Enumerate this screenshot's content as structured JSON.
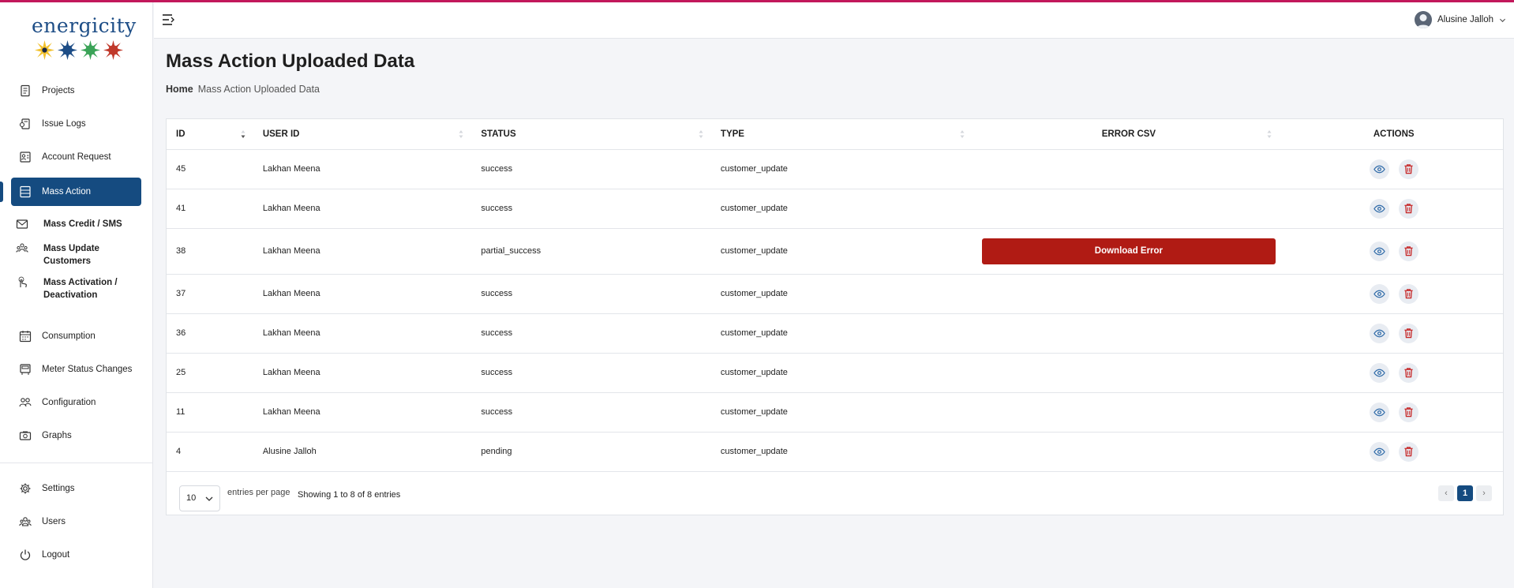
{
  "brand": {
    "name": "energicity",
    "sun_colors": [
      "#f2c12e",
      "#1d4d86",
      "#3aa357",
      "#c0392b"
    ]
  },
  "sidebar": {
    "items": [
      {
        "label": "Projects",
        "icon": "document-icon"
      },
      {
        "label": "Issue Logs",
        "icon": "issue-log-icon"
      },
      {
        "label": "Account Request",
        "icon": "account-request-icon"
      },
      {
        "label": "Mass Action",
        "icon": "grid-icon",
        "active": true
      }
    ],
    "sub_items": [
      {
        "label": "Mass Credit / SMS",
        "icon": "envelope-icon"
      },
      {
        "label": "Mass Update Customers",
        "icon": "users-icon"
      },
      {
        "label": "Mass Activation / Deactivation",
        "icon": "hand-pointer-icon"
      }
    ],
    "items_lower": [
      {
        "label": "Consumption",
        "icon": "calendar-icon"
      },
      {
        "label": "Meter Status Changes",
        "icon": "meter-icon"
      },
      {
        "label": "Configuration",
        "icon": "people-icon"
      },
      {
        "label": "Graphs",
        "icon": "camera-icon"
      }
    ],
    "items_bottom": [
      {
        "label": "Settings",
        "icon": "gear-icon"
      },
      {
        "label": "Users",
        "icon": "users-group-icon"
      },
      {
        "label": "Logout",
        "icon": "power-icon"
      }
    ]
  },
  "header": {
    "user_name": "Alusine Jalloh"
  },
  "page": {
    "title": "Mass Action Uploaded Data",
    "breadcrumb_home": "Home",
    "breadcrumb_current": "Mass Action Uploaded Data"
  },
  "table": {
    "columns": [
      "ID",
      "USER ID",
      "STATUS",
      "TYPE",
      "ERROR CSV",
      "ACTIONS"
    ],
    "download_label": "Download Error",
    "rows": [
      {
        "id": "45",
        "user": "Lakhan Meena",
        "status": "success",
        "type": "customer_update",
        "error_csv": false
      },
      {
        "id": "41",
        "user": "Lakhan Meena",
        "status": "success",
        "type": "customer_update",
        "error_csv": false
      },
      {
        "id": "38",
        "user": "Lakhan Meena",
        "status": "partial_success",
        "type": "customer_update",
        "error_csv": true
      },
      {
        "id": "37",
        "user": "Lakhan Meena",
        "status": "success",
        "type": "customer_update",
        "error_csv": false
      },
      {
        "id": "36",
        "user": "Lakhan Meena",
        "status": "success",
        "type": "customer_update",
        "error_csv": false
      },
      {
        "id": "25",
        "user": "Lakhan Meena",
        "status": "success",
        "type": "customer_update",
        "error_csv": false
      },
      {
        "id": "11",
        "user": "Lakhan Meena",
        "status": "success",
        "type": "customer_update",
        "error_csv": false
      },
      {
        "id": "4",
        "user": "Alusine Jalloh",
        "status": "pending",
        "type": "customer_update",
        "error_csv": false
      }
    ]
  },
  "pagination": {
    "per_page": "10",
    "per_page_label": "entries per page",
    "showing": "Showing 1 to 8 of 8 entries",
    "prev": "‹",
    "current": "1",
    "next": "›"
  },
  "colors": {
    "accent": "#154b80",
    "danger": "#b01b14",
    "top_line": "#c2185b"
  }
}
